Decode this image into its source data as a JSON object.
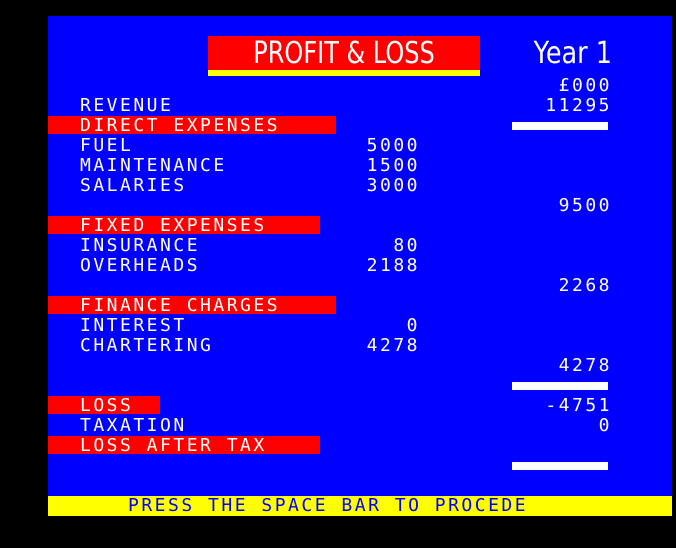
{
  "header": {
    "title": "PROFIT & LOSS",
    "year": "Year 1",
    "unit": "£000"
  },
  "revenue": {
    "label": "REVENUE",
    "total": "11295"
  },
  "direct_expenses": {
    "heading": "DIRECT EXPENSES",
    "items": [
      {
        "label": "FUEL",
        "value": "5000"
      },
      {
        "label": "MAINTENANCE",
        "value": "1500"
      },
      {
        "label": "SALARIES",
        "value": "3000"
      }
    ],
    "total": "9500"
  },
  "fixed_expenses": {
    "heading": "FIXED EXPENSES",
    "items": [
      {
        "label": "INSURANCE",
        "value": "80"
      },
      {
        "label": "OVERHEADS",
        "value": "2188"
      }
    ],
    "total": "2268"
  },
  "finance_charges": {
    "heading": "FINANCE CHARGES",
    "items": [
      {
        "label": "INTEREST",
        "value": "0"
      },
      {
        "label": "CHARTERING",
        "value": "4278"
      }
    ],
    "total": "4278"
  },
  "result": {
    "loss_label": "LOSS",
    "loss_value": "-4751",
    "taxation_label": "TAXATION",
    "taxation_value": "0",
    "after_tax_label": "LOSS AFTER TAX"
  },
  "footer": {
    "prompt": "PRESS THE SPACE BAR TO PROCEDE"
  },
  "colors": {
    "background": "#0000ff",
    "highlight": "#ff0000",
    "accent": "#ffff00",
    "text": "#ffffff"
  }
}
